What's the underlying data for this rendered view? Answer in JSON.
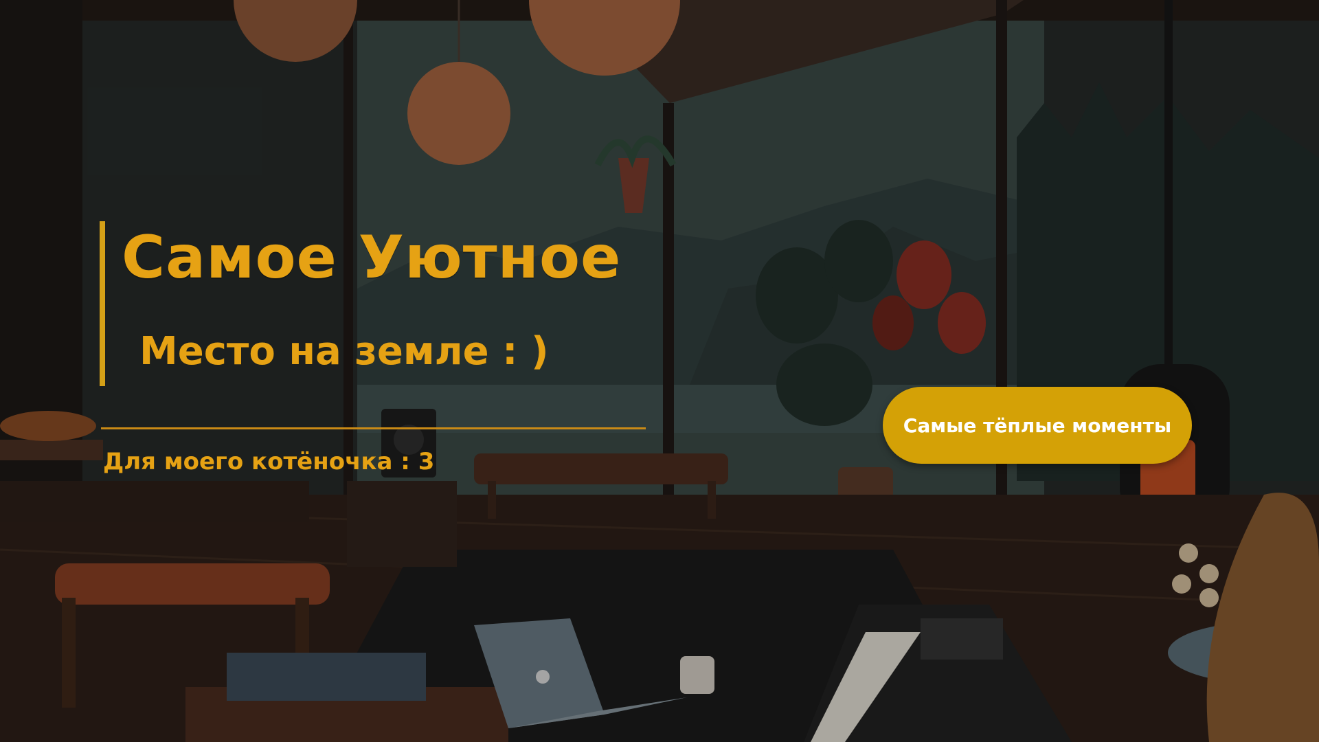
{
  "hero": {
    "title": "Самое Уютное",
    "subtitle": "Место на земле : )"
  },
  "dedication": "Для моего котёночка : 3",
  "cta": {
    "label": "Самые тёплые моменты"
  },
  "colors": {
    "accent": "#e6a214",
    "button": "#d4a106",
    "button_text": "#ffffff",
    "divider": "#c98a16"
  },
  "background": {
    "icon": "cozy-cabin-room-illustration"
  }
}
